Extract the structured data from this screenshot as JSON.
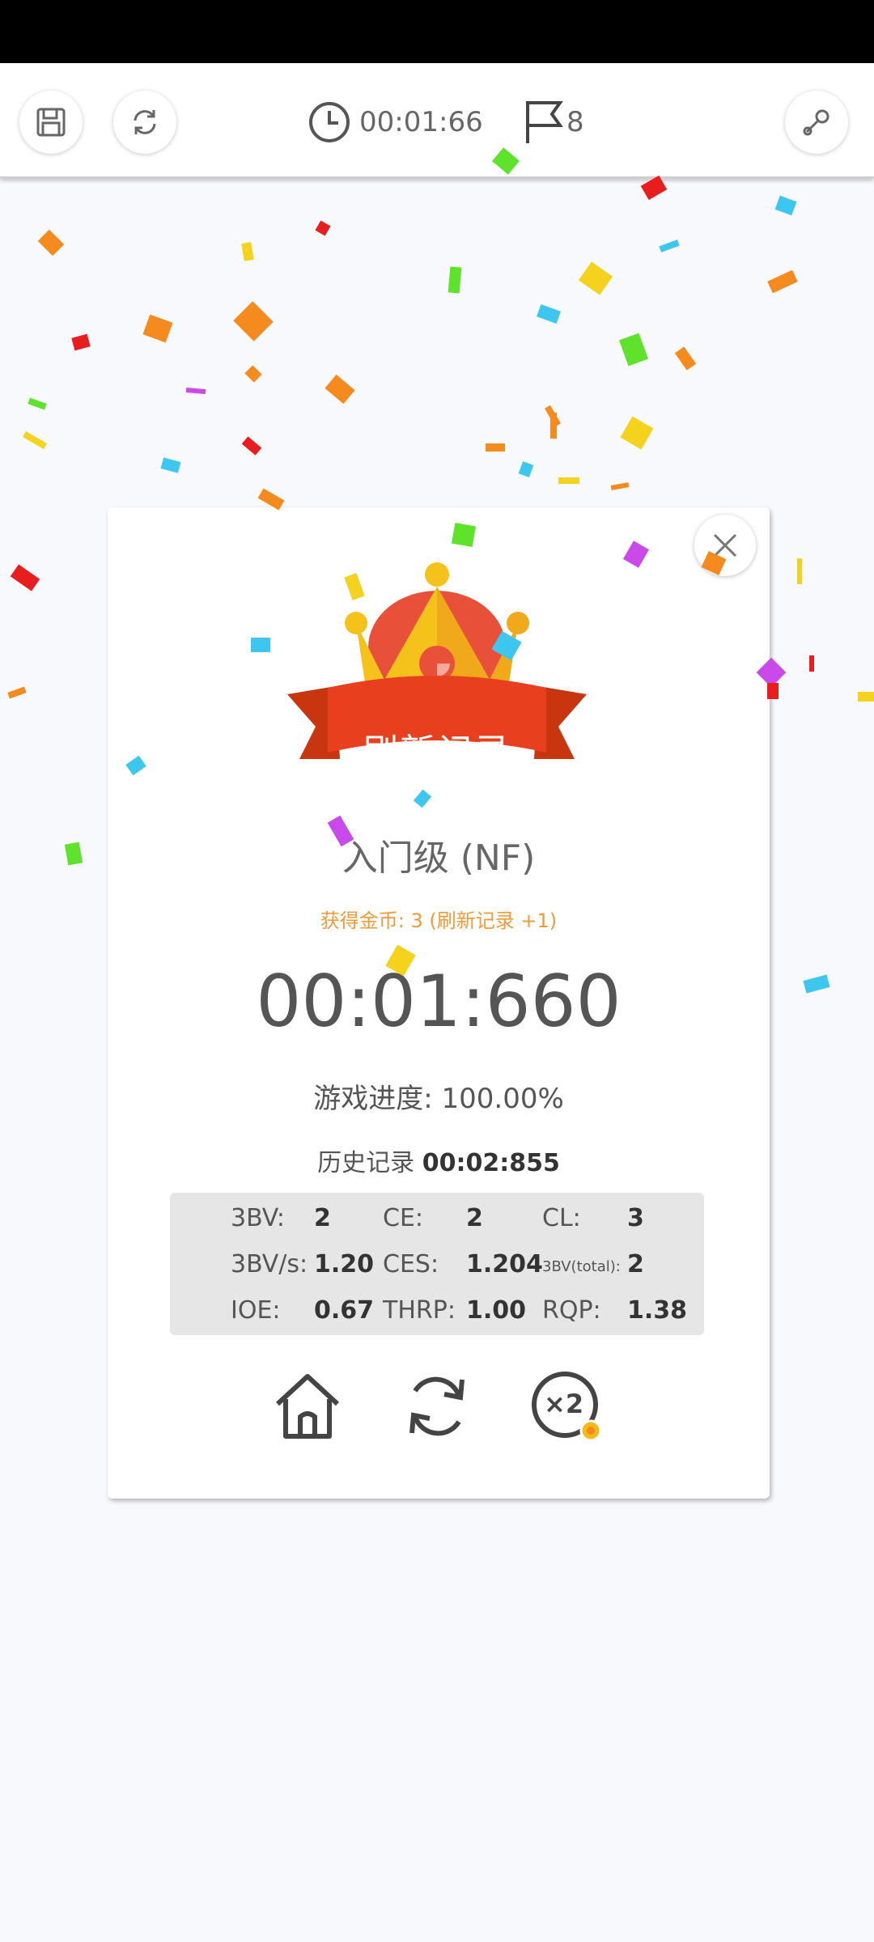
{
  "toolbar": {
    "timer": "00:01:66",
    "flags": "8",
    "icons": [
      "save-icon",
      "refresh-icon",
      "clock-icon",
      "flag-icon",
      "wrench-icon"
    ]
  },
  "dialog": {
    "banner_title": "刷新记录",
    "level": "入门级 (NF)",
    "coins": "获得金币: 3 (刷新记录 +1)",
    "time": "00:01:660",
    "progress_label": "游戏进度:",
    "progress_value": "100.00%",
    "history_label": "历史记录",
    "history_value": "00:02:855",
    "stats": {
      "bv_label": "3BV:",
      "bv_value": "2",
      "ce_label": "CE:",
      "ce_value": "2",
      "cl_label": "CL:",
      "cl_value": "3",
      "bvs_label": "3BV/s:",
      "bvs_value": "1.20",
      "ces_label": "CES:",
      "ces_value": "1.204",
      "bvtotal_label": "3BV(total):",
      "bvtotal_value": "2",
      "ioe_label": "IOE:",
      "ioe_value": "0.67",
      "thrp_label": "THRP:",
      "thrp_value": "1.00",
      "rqp_label": "RQP:",
      "rqp_value": "1.38"
    },
    "buttons": {
      "double_label": "×2"
    }
  },
  "colors": {
    "banner_red": "#e8401e",
    "crown_gold": "#f5c21b",
    "coin_orange": "#f09a3a"
  }
}
